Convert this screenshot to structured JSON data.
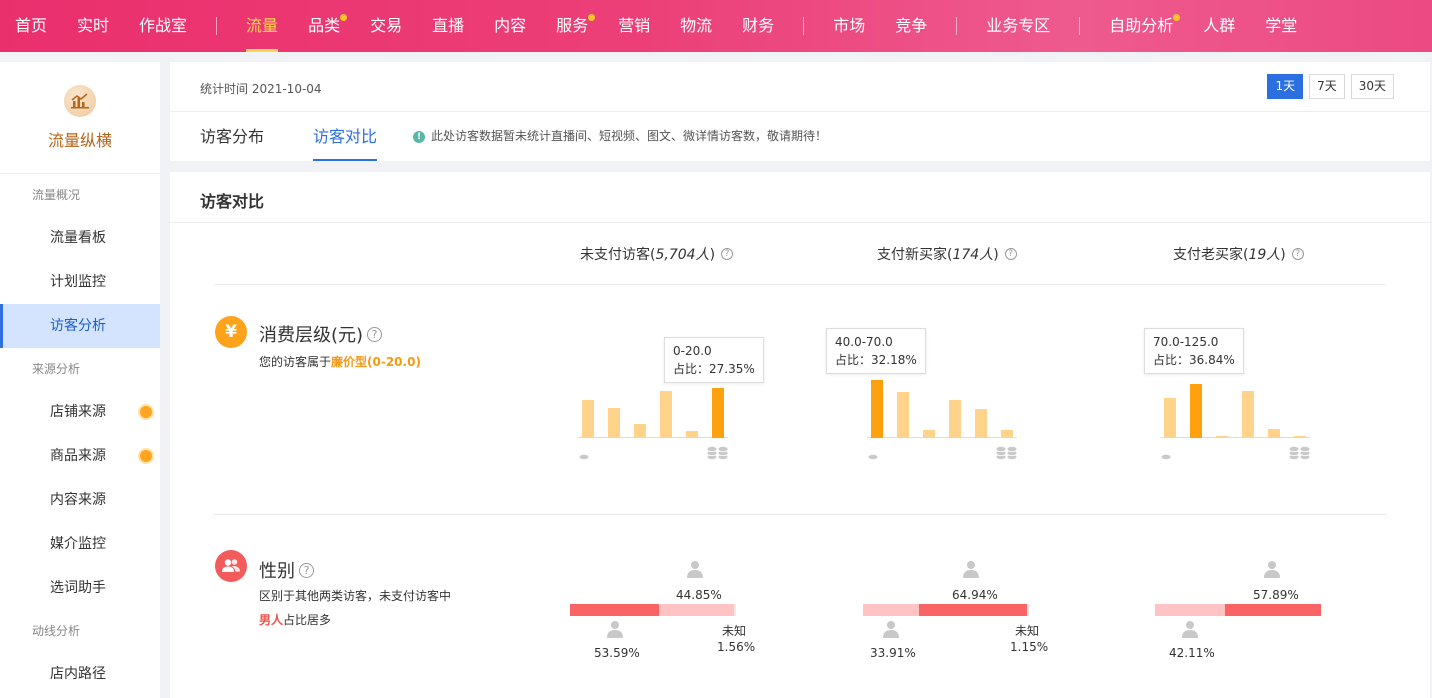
{
  "topnav": {
    "items": [
      "首页",
      "实时",
      "作战室",
      "流量",
      "品类",
      "交易",
      "直播",
      "内容",
      "服务",
      "营销",
      "物流",
      "财务",
      "市场",
      "竞争",
      "业务专区",
      "自助分析",
      "人群",
      "学堂"
    ]
  },
  "sidebar": {
    "brand": "流量纵横",
    "groups": {
      "overview": "流量概况",
      "source": "来源分析",
      "path": "动线分析"
    },
    "items": {
      "board": "流量看板",
      "plan": "计划监控",
      "visitor": "访客分析",
      "shop_source": "店铺来源",
      "product_source": "商品来源",
      "content_source": "内容来源",
      "media": "媒介监控",
      "keyword": "选词助手",
      "route": "店内路径"
    }
  },
  "header": {
    "stat_time": "统计时间 2021-10-04",
    "day_buttons": [
      "1天",
      "7天",
      "30天"
    ],
    "tabs": [
      "访客分布",
      "访客对比"
    ],
    "notice": "此处访客数据暂未统计直播间、短视频、图文、微详情访客数，敬请期待！"
  },
  "main": {
    "title": "访客对比",
    "columns": [
      {
        "label": "未支付访客(",
        "count": "5,704人",
        "end": ")"
      },
      {
        "label": "支付新买家(",
        "count": "174人",
        "end": ")"
      },
      {
        "label": "支付老买家(",
        "count": "19人",
        "end": ")"
      }
    ],
    "consumption": {
      "icon_char": "¥",
      "title": "消费层级(元)",
      "desc_prefix": "您的访客属于",
      "desc_highlight": "廉价型(0-20.0)",
      "tooltips": [
        {
          "range": "0-20.0",
          "ratio": "占比：27.35%"
        },
        {
          "range": "40.0-70.0",
          "ratio": "占比：32.18%"
        },
        {
          "range": "70.0-125.0",
          "ratio": "占比：36.84%"
        }
      ]
    },
    "gender": {
      "title": "性别",
      "desc_line1": "区别于其他两类访客，未支付访客中",
      "desc_highlight": "男人",
      "desc_suffix": "占比居多",
      "unknown_label": "未知",
      "groups": [
        {
          "male": "53.59%",
          "female": "44.85%",
          "unknown": "1.56%"
        },
        {
          "male": "33.91%",
          "female": "64.94%",
          "unknown": "1.15%"
        },
        {
          "male": "42.11%",
          "female": "57.89%",
          "unknown": ""
        }
      ]
    }
  },
  "chart_data": [
    {
      "type": "bar",
      "title": "未支付访客",
      "values": [
        38,
        30,
        14,
        47,
        7,
        50
      ],
      "highlight_index": 5,
      "colors": {
        "normal": "#ffd48a",
        "highlight": "#ffa00f"
      }
    },
    {
      "type": "bar",
      "title": "支付新买家",
      "values": [
        58,
        46,
        8,
        38,
        29,
        8
      ],
      "highlight_index": 0,
      "colors": {
        "normal": "#ffd48a",
        "highlight": "#ffa00f"
      }
    },
    {
      "type": "bar",
      "title": "支付老买家",
      "values": [
        40,
        54,
        2,
        47,
        9,
        2
      ],
      "highlight_index": 1,
      "colors": {
        "normal": "#ffd48a",
        "highlight": "#ffa00f"
      }
    }
  ],
  "colors": {
    "nav_active": "#ffd84d",
    "primary_blue": "#2c6fe0",
    "male_bar": "#fa6464",
    "female_bar": "#ffc3c3",
    "unknown_bar": "#fde4e4",
    "orange_accent": "#f59a16"
  }
}
